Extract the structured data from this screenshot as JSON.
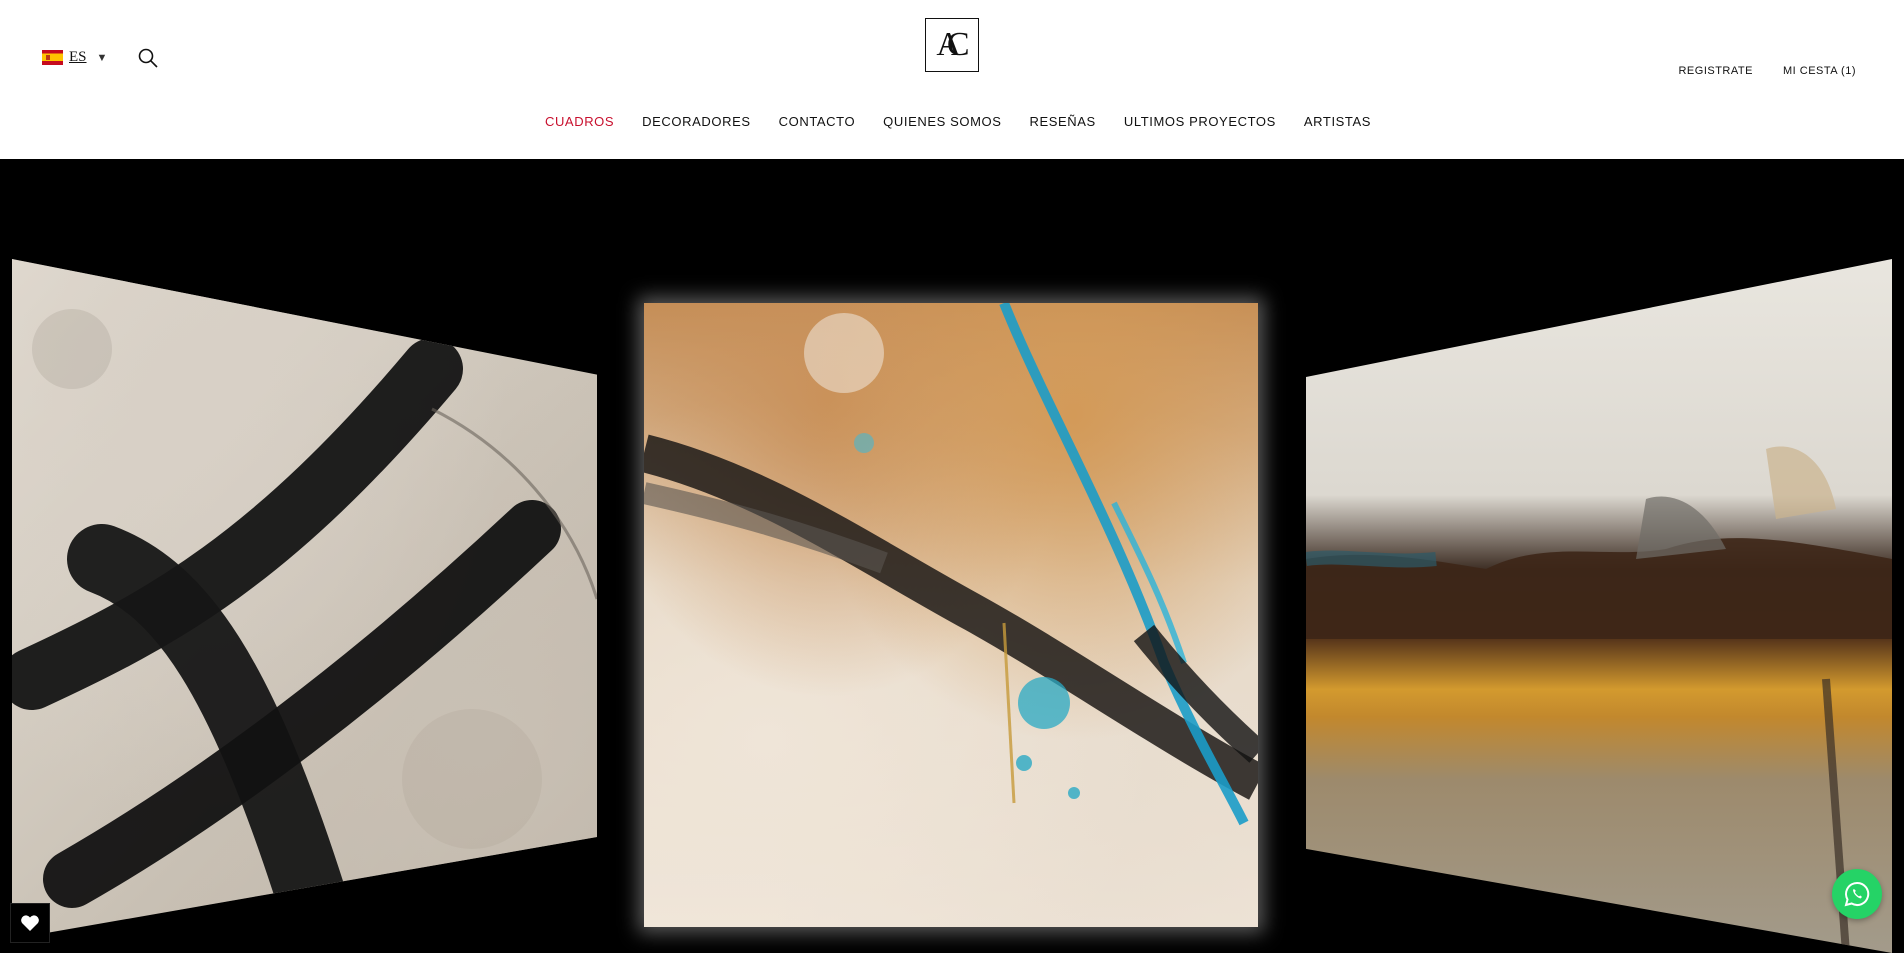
{
  "language": {
    "code": "ES",
    "flag_icon": "spain-flag-icon"
  },
  "header": {
    "logo_text": "AC",
    "search_icon": "search-icon"
  },
  "account": {
    "register_label": "REGISTRATE",
    "cart_label": "MI CESTA (1)"
  },
  "nav": {
    "items": [
      {
        "label": "CUADROS",
        "active": true
      },
      {
        "label": "DECORADORES",
        "active": false
      },
      {
        "label": "CONTACTO",
        "active": false
      },
      {
        "label": "QUIENES SOMOS",
        "active": false
      },
      {
        "label": "RESEÑAS",
        "active": false
      },
      {
        "label": "ULTIMOS PROYECTOS",
        "active": false
      },
      {
        "label": "ARTISTAS",
        "active": false
      }
    ]
  },
  "hero": {
    "slides": [
      "abstract-black-strokes",
      "abstract-ochre-turquoise",
      "abstract-landscape-textured"
    ]
  },
  "floating": {
    "whatsapp_icon": "whatsapp-icon",
    "wishlist_icon": "heart-icon"
  },
  "colors": {
    "accent": "#c8102e",
    "whatsapp": "#25d366",
    "hero_background": "#000000"
  }
}
